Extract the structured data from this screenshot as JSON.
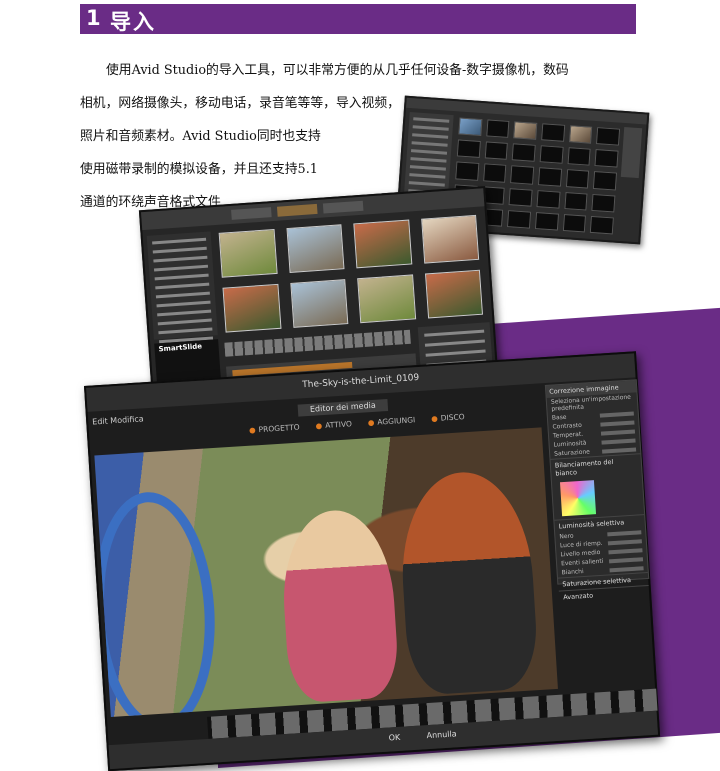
{
  "header": {
    "number": "1",
    "title": "导入"
  },
  "paragraph": {
    "lines": [
      "使用Avid Studio的导入工具，可以非常方便的从几乎任何设备-数字摄像机，数码",
      "相机，网络摄像头，移动电话，录音笔等等，导入视频，",
      "照片和音频素材。Avid Studio同时也支持",
      "使用磁带录制的模拟设备，并且还支持5.1",
      "通道的环绕声音格式文件"
    ]
  },
  "screenshot_main": {
    "window_title": "The-Sky-is-the-Limit_0109",
    "menu": "Edit Modifica",
    "editor_label": "Editor dei media",
    "tabs": [
      "PROGETTO",
      "ATTIVO",
      "AGGIUNGI",
      "DISCO"
    ],
    "side_panel": {
      "header": "Correzione immagine",
      "preset_label": "Seleziona un'impostazione predefinita",
      "rows": [
        "Base",
        "Contrasto",
        "Temperat.",
        "Luminosità",
        "Saturazione"
      ],
      "section_white_balance": "Bilanciamento del bianco",
      "section_selective": "Luminosità selettiva",
      "selective_rows": [
        "Nero",
        "Luce di riemp.",
        "Livello medio",
        "Eventi salienti",
        "Bianchi"
      ],
      "section_saturation": "Saturazione selettiva",
      "section_advanced": "Avanzato"
    },
    "ok": "OK",
    "cancel": "Annulla"
  },
  "screenshot_library": {
    "smart_label": "SmartSlide"
  }
}
